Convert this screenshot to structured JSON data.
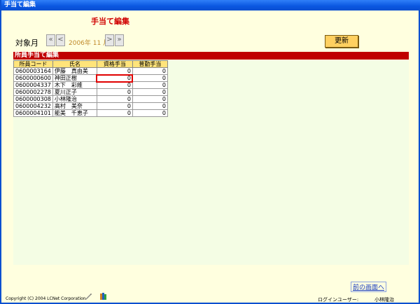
{
  "window_title": "手当て編集",
  "heading": "手当て編集",
  "month_label": "対象月",
  "month_value": "2006年 11 月",
  "nav": {
    "first": "«",
    "prev": "<",
    "next": ">",
    "last": "»"
  },
  "update_button": "更新",
  "section_title": "所員手当て編集",
  "columns": [
    "所員コード",
    "氏名",
    "資格手当",
    "普勤手当"
  ],
  "rows": [
    {
      "code": "0600003164",
      "name": "伊藤　真由美",
      "a": "0",
      "b": "0"
    },
    {
      "code": "0600000600",
      "name": "神田正樹",
      "a": "0",
      "b": "0"
    },
    {
      "code": "0600004337",
      "name": "木下　彩維",
      "a": "0",
      "b": "0"
    },
    {
      "code": "0600002278",
      "name": "夏川正子",
      "a": "0",
      "b": "0"
    },
    {
      "code": "0600000308",
      "name": "小林隆治",
      "a": "0",
      "b": "0"
    },
    {
      "code": "0600004232",
      "name": "高村　美奈",
      "a": "0",
      "b": "0"
    },
    {
      "code": "0600004101",
      "name": "能美　千恵子",
      "a": "0",
      "b": "0"
    }
  ],
  "copyright": "Copyright (C) 2004 LCNet Corporation",
  "prev_screen_link": "前の画面へ",
  "login_label": "ログインユーザー:",
  "login_user": "小林隆治",
  "colors": {
    "accent": "#c00000",
    "header": "#ffe47a",
    "button": "#ffd060"
  }
}
